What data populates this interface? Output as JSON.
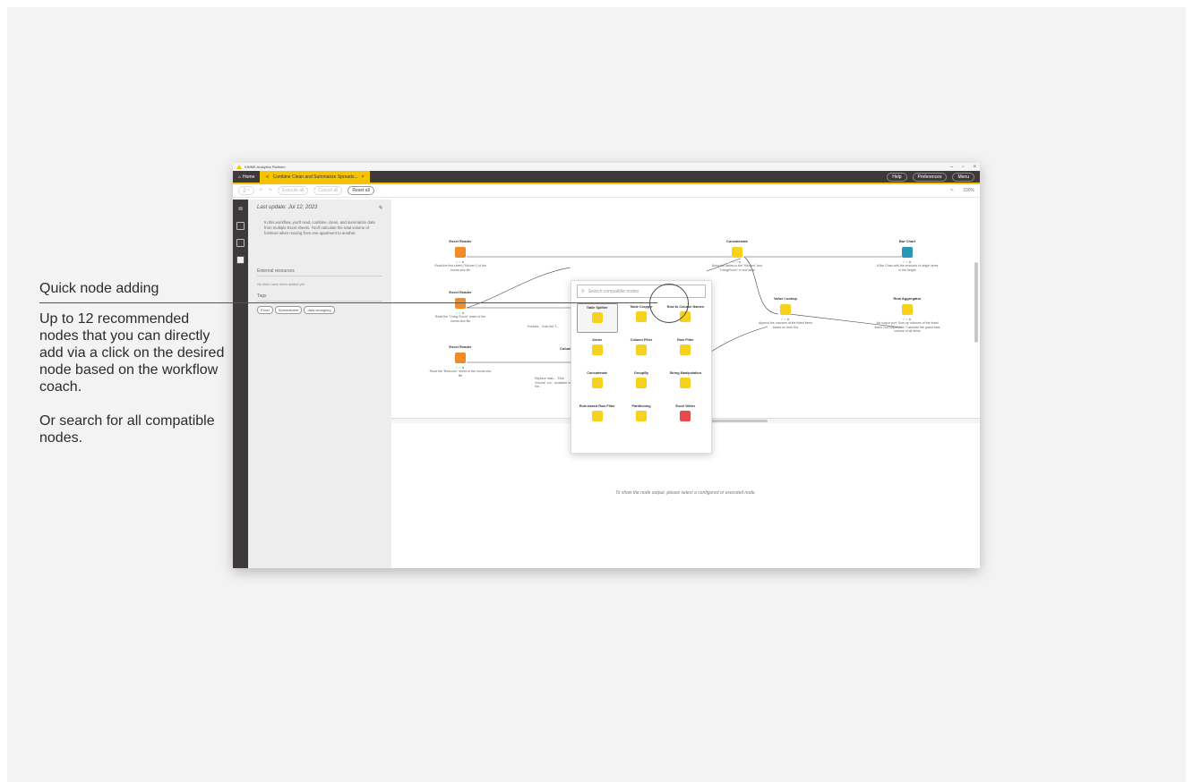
{
  "callout": {
    "title": "Quick node adding",
    "body1": "Up to 12 recommended nodes that you can directly add via a click on the desired node based on the workflow coach.",
    "body2": "Or search for all compatible nodes."
  },
  "app": {
    "window_title": "KNIME Analytics Platform",
    "tabs": {
      "home": "Home",
      "active": "Combine Clean and Summarize Spreads..."
    },
    "header_buttons": {
      "help": "Help",
      "preferences": "Preferences",
      "menu": "Menu"
    },
    "toolbar": {
      "execute_all": "Execute all",
      "cancel_all": "Cancel all",
      "reset_all": "Reset all",
      "zoom": "100%"
    },
    "panel": {
      "last_update": "Last update: Jul 12, 2023",
      "description": "In this workflow, you'll read, combine, clean, and summarize data from multiple Excel sheets. You'll calculate the total volume of furniture when moving from one apartment to another.",
      "external_resources": "External resources",
      "no_links": "No links have been added yet",
      "tags_heading": "Tags",
      "tags": [
        "Excel",
        "Spreadsheet",
        "data wrangling"
      ]
    },
    "nodes": [
      {
        "title": "Excel Reader",
        "desc": "Read the first sheet (\"Kitchen\") of the rooms.xlsx file"
      },
      {
        "title": "Excel Reader",
        "desc": "Read the \"Living Room\" sheet of the rooms.xlsx file"
      },
      {
        "title": "Excel Reader",
        "desc": "Read the \"Bedroom\" sheet of the rooms.xlsx file"
      },
      {
        "title": "Concatenate",
        "desc": "Bring the tables in the \"Kitchen\" and \"LivingRoom\" in one table"
      },
      {
        "title": "Bar Chart",
        "desc": "A Bar Chart with the amounts of single items in the height"
      },
      {
        "title": "Value Lookup",
        "desc": "Append the volumes of the listed items based on their IDs"
      },
      {
        "title": "Row Aggregator",
        "desc": "1st output port: Sum up volumes of the listed items 2nd output port: Calculate the grand total volume of all items"
      }
    ],
    "partial_labels": {
      "column": "Colum",
      "node2_desc": "Exclude... from the \"L...",
      "node3_desc": "Replace miss... \"Dich Volume\" col... available in the..."
    },
    "quick_add": {
      "placeholder": "Search compatible nodes",
      "items": [
        "Table Splitter",
        "Table Cropper",
        "Row to Column Names",
        "Joiner",
        "Column Filter",
        "Row Filter",
        "Concatenate",
        "GroupBy",
        "String Manipulation",
        "Rule-based Row Filter",
        "Partitioning",
        "Excel Writer"
      ]
    },
    "output_message": "To show the node output, please select a configured or executed node."
  }
}
